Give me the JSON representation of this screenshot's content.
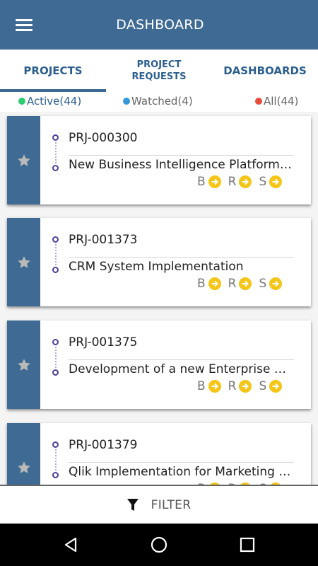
{
  "header": {
    "title": "DASHBOARD"
  },
  "tabs": [
    {
      "label": "PROJECTS",
      "active": true
    },
    {
      "label": "PROJECT\nREQUESTS",
      "active": false
    },
    {
      "label": "DASHBOARDS",
      "active": false
    }
  ],
  "filters": [
    {
      "label": "Active(44)",
      "color": "#2ecc71"
    },
    {
      "label": "Watched(4)",
      "color": "#3498db"
    },
    {
      "label": "All(44)",
      "color": "#e74c3c"
    }
  ],
  "projects": [
    {
      "id": "PRJ-000300",
      "name": "New Business Intelligence Platform Implementation"
    },
    {
      "id": "PRJ-001373",
      "name": "CRM System Implementation"
    },
    {
      "id": "PRJ-001375",
      "name": "Development of a new Enterprise Architecture"
    },
    {
      "id": "PRJ-001379",
      "name": "Qlik Implementation for Marketing Department"
    }
  ],
  "card_actions": {
    "b": "B",
    "r": "R",
    "s": "S"
  },
  "bottom_bar": {
    "filter_label": "FILTER"
  },
  "colors": {
    "primary": "#3e6a93",
    "accent": "#f5c518",
    "timeline": "#4b3f9c"
  },
  "icons": {
    "menu": "menu-icon",
    "star": "star-icon",
    "arrow": "arrow-right-circle-icon",
    "filter": "funnel-icon",
    "back": "back-icon",
    "home": "home-icon",
    "recent": "recent-apps-icon"
  }
}
